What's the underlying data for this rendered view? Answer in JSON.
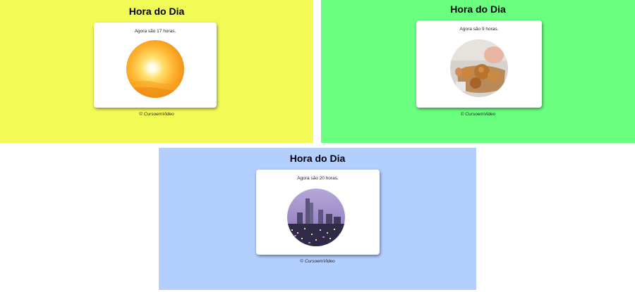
{
  "panels": [
    {
      "title": "Hora do Dia",
      "message": "Agora são 17 horas.",
      "footer": "© CursoemVideo",
      "background": "#f2fb56",
      "image": "sunset-sun"
    },
    {
      "title": "Hora do Dia",
      "message": "Agora são 9 horas.",
      "footer": "© CursoemVideo",
      "background": "#6aff7e",
      "image": "breakfast-bread"
    },
    {
      "title": "Hora do Dia",
      "message": "Agora são 20 horas.",
      "footer": "© CursoemVideo",
      "background": "#b3cffd",
      "image": "city-night"
    }
  ]
}
